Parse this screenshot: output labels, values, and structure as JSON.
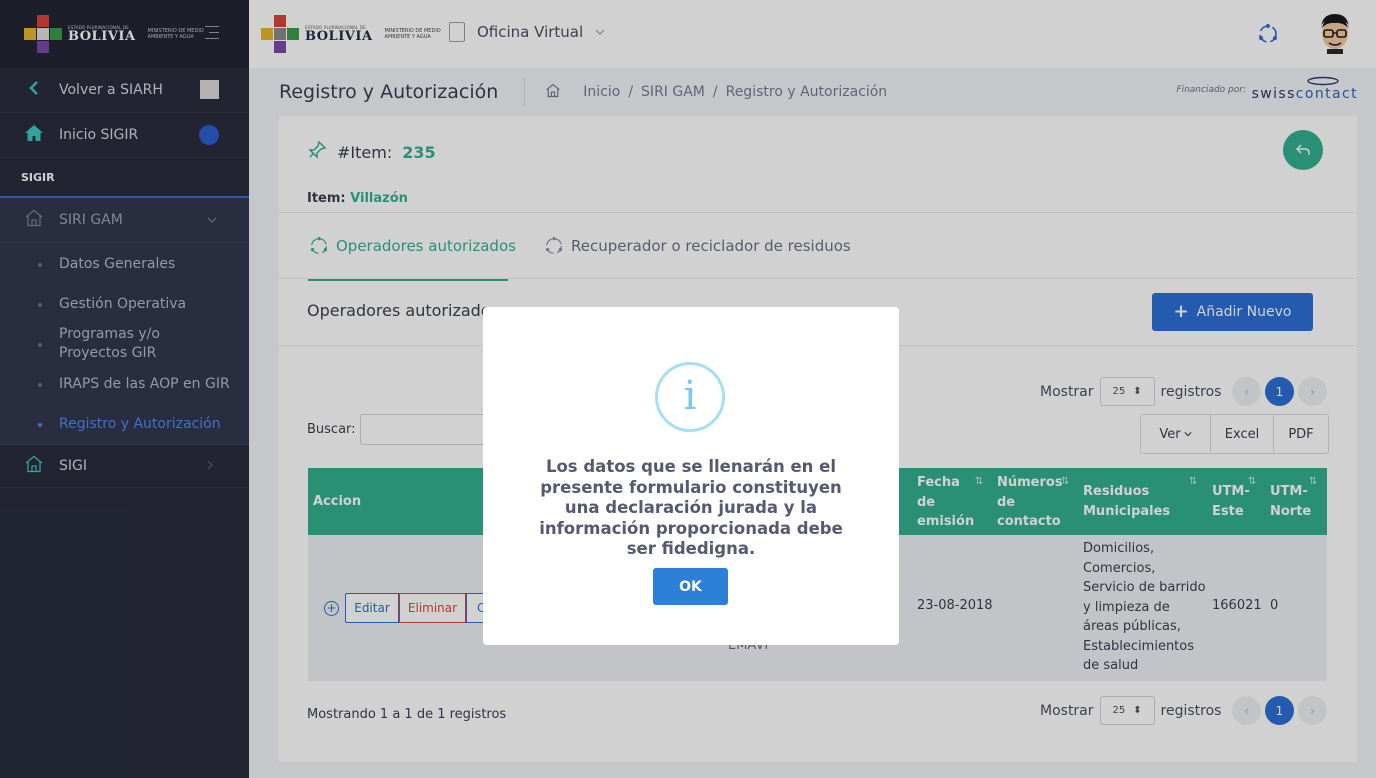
{
  "brand": {
    "country_small": "ESTADO PLURINACIONAL DE",
    "country": "BOLIVIA",
    "ministry": "MINISTERIO DE MEDIO AMBIENTE Y AGUA"
  },
  "sidebar": {
    "back": "Volver a SIARH",
    "home": "Inicio SIGIR",
    "section": "SIGIR",
    "group": "SIRI GAM",
    "sub_items": [
      {
        "label": "Datos Generales"
      },
      {
        "label": "Gestión Operativa"
      },
      {
        "label": "Programas y/o Proyectos GIR"
      },
      {
        "label": "IRAPS de las AOP en GIR"
      },
      {
        "label": "Registro y Autorización"
      }
    ],
    "sigi": "SIGI"
  },
  "topbar": {
    "app": "Oficina Virtual"
  },
  "subheader": {
    "title": "Registro y Autorización",
    "crumbs": [
      "Inicio",
      "/",
      "SIRI GAM",
      "/",
      "Registro y Autorización"
    ],
    "funded": "Financiado por:",
    "sponsor_a": "swiss",
    "sponsor_b": "contact"
  },
  "card": {
    "item_label": "#Item:",
    "item_number": "235",
    "item_name_label": "Item:",
    "item_name": "Villazón",
    "tabs": [
      "Operadores autorizados",
      "Recuperador o reciclador de residuos"
    ],
    "section_title": "Operadores autorizados",
    "add_button": "Añadir Nuevo"
  },
  "table_controls": {
    "show": "Mostrar",
    "page_size": "25",
    "records": "registros",
    "search": "Buscar:",
    "view_btn": "Ver",
    "excel_btn": "Excel",
    "pdf_btn": "PDF",
    "current_page": "1",
    "info": "Mostrando 1 a 1 de 1 registros"
  },
  "table": {
    "headers": {
      "accion": "Accion",
      "fecha": [
        "Fecha",
        "de",
        "emisión"
      ],
      "numeros": [
        "Números",
        "de",
        "contacto"
      ],
      "residuos": [
        "Residuos",
        "Municipales"
      ],
      "utm_este": [
        "UTM-",
        "Este"
      ],
      "utm_norte": [
        "UTM-",
        "Norte"
      ]
    },
    "row": {
      "edit": "Editar",
      "delete": "Eliminar",
      "third": "Co",
      "partial": "EMAVI",
      "fecha": "23-08-2018",
      "residuos": [
        "Domicilios,",
        "Comercios,",
        "Servicio de barrido",
        "y limpieza de",
        "áreas públicas,",
        "Establecimientos",
        "de salud"
      ],
      "utm_este": "166021",
      "utm_norte": "0"
    }
  },
  "modal": {
    "icon": "i",
    "text": "Los datos que se llenarán en el presente formulario constituyen una declaración jurada y la información proporcionada debe ser fidedigna.",
    "ok": "OK"
  },
  "colors": {
    "accent_green": "#34b08f",
    "primary_blue": "#2d6fd6",
    "sidebar_bg": "#2a2d3e"
  }
}
